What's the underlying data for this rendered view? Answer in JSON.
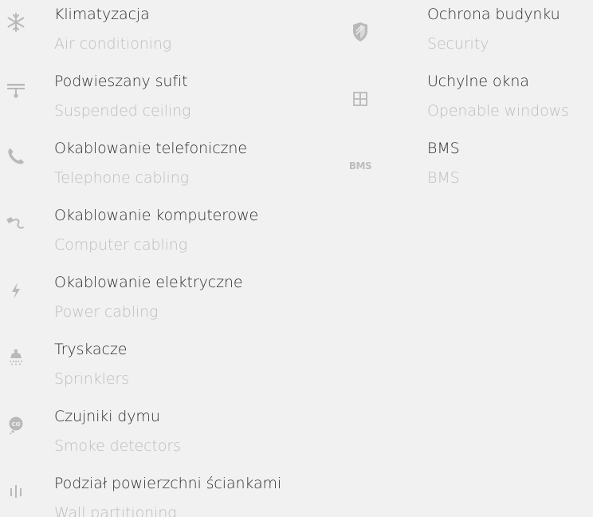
{
  "left_column": [
    {
      "title": "Klimatyzacja",
      "subtitle": "Air conditioning",
      "icon": "snowflake-icon"
    },
    {
      "title": "Podwieszany sufit",
      "subtitle": "Suspended ceiling",
      "icon": "ceiling-lamp-icon"
    },
    {
      "title": "Okablowanie telefoniczne",
      "subtitle": "Telephone cabling",
      "icon": "phone-icon"
    },
    {
      "title": "Okablowanie komputerowe",
      "subtitle": "Computer cabling",
      "icon": "network-cable-icon"
    },
    {
      "title": "Okablowanie elektryczne",
      "subtitle": "Power cabling",
      "icon": "lightning-icon"
    },
    {
      "title": "Tryskacze",
      "subtitle": "Sprinklers",
      "icon": "sprinkler-icon"
    },
    {
      "title": "Czujniki dymu",
      "subtitle": "Smoke detectors",
      "icon": "smoke-detector-icon"
    },
    {
      "title": "Podział powierzchni ściankami",
      "subtitle": "Wall partitioning",
      "icon": "partition-icon"
    }
  ],
  "right_column": [
    {
      "title": "Ochrona budynku",
      "subtitle": "Security",
      "icon": "shield-icon"
    },
    {
      "title": "Uchylne okna",
      "subtitle": "Openable windows",
      "icon": "window-icon"
    },
    {
      "title": "BMS",
      "subtitle": "BMS",
      "icon": "bms-icon",
      "icon_text": "BMS"
    }
  ],
  "colors": {
    "background": "#f1f1f1",
    "title": "#2f2f2f",
    "subtitle": "#bdbdbd",
    "icon": "#b9b9b9"
  }
}
